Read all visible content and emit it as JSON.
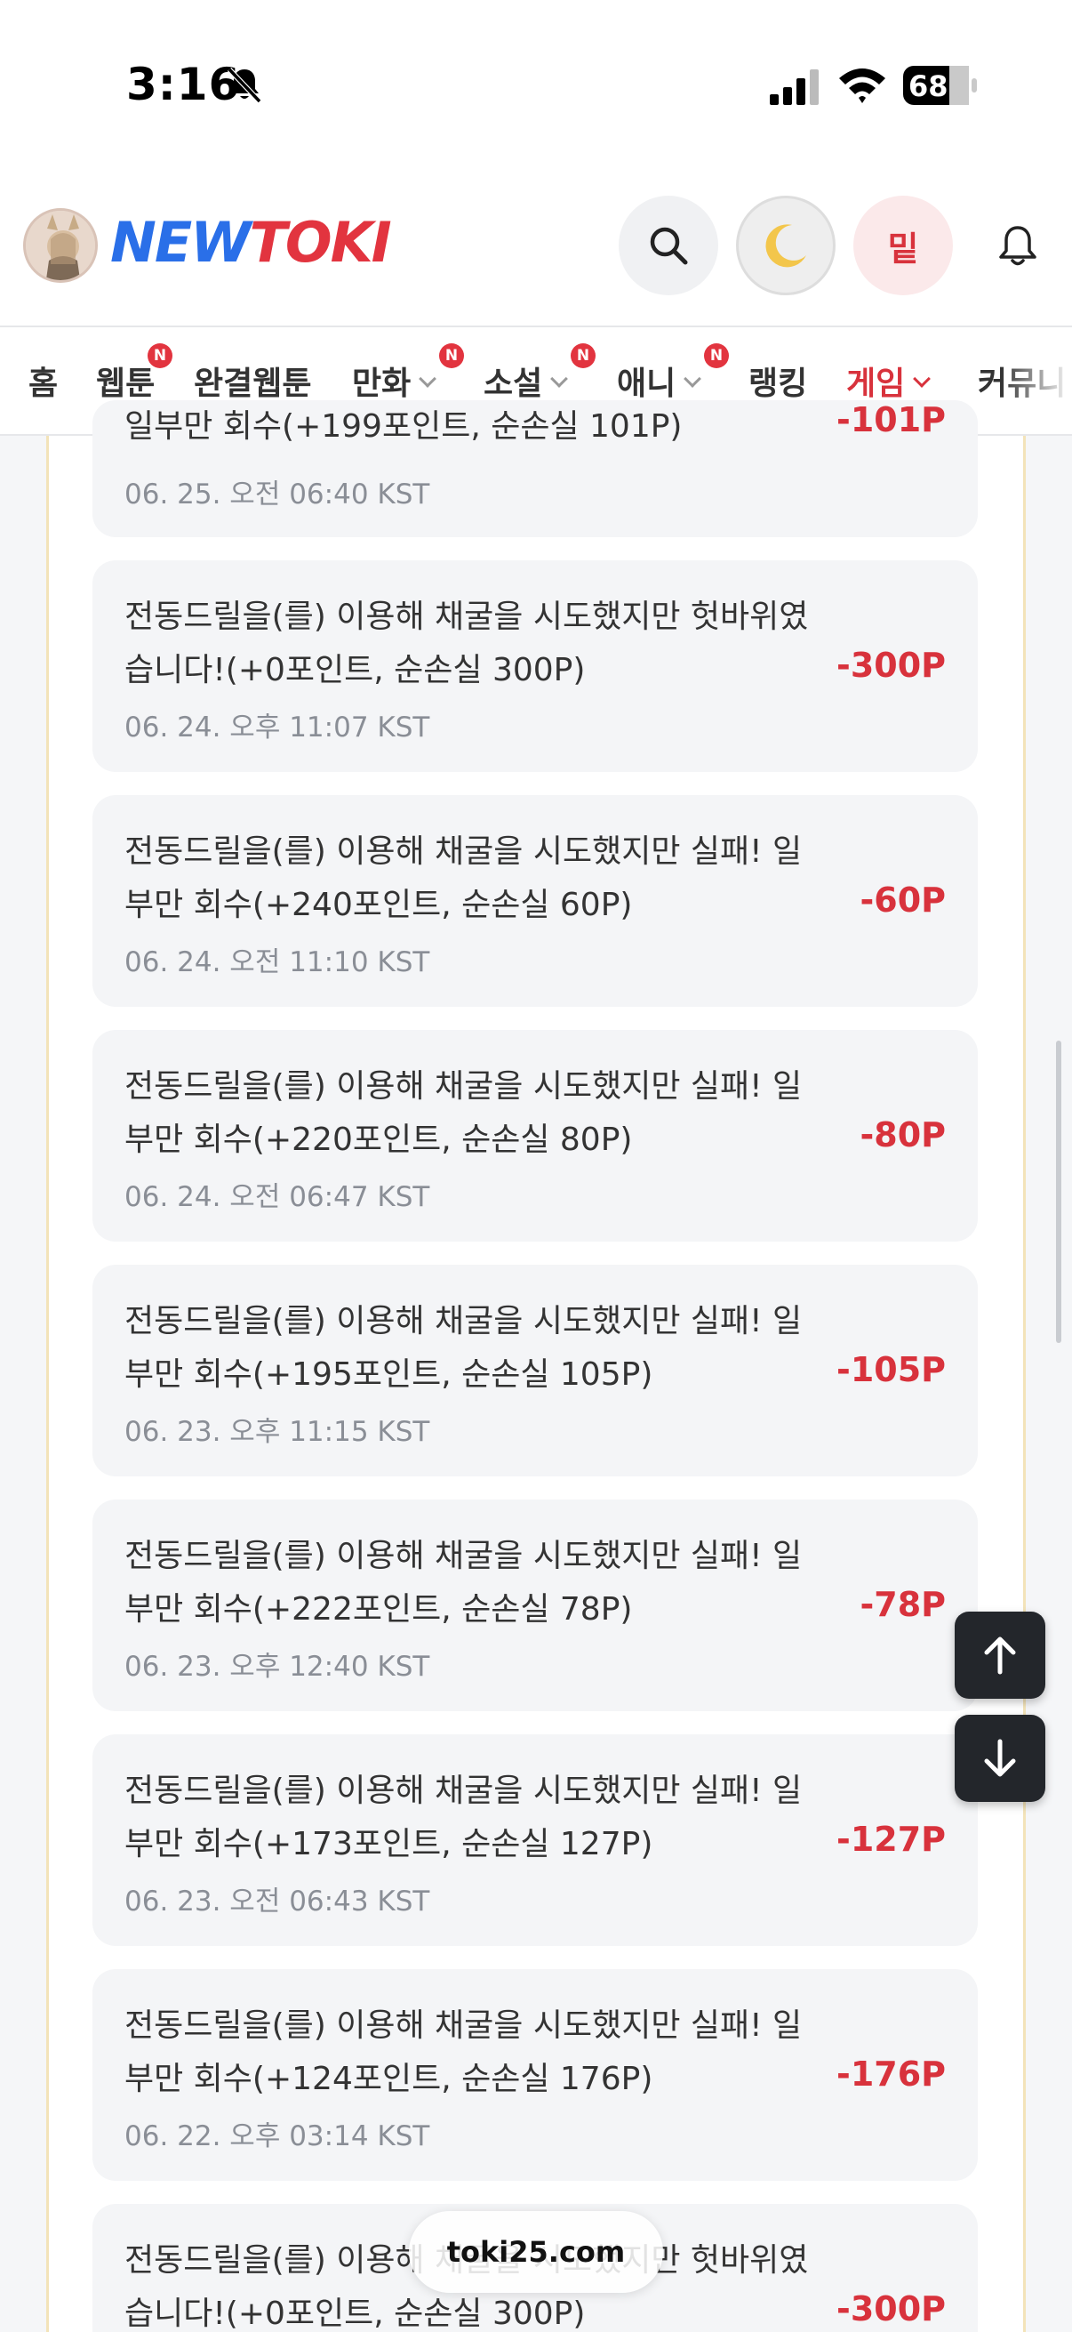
{
  "status_bar": {
    "time": "3:16",
    "battery": "68"
  },
  "header": {
    "logo_new": "NEW",
    "logo_toki": "TOKI",
    "user_initial": "밑"
  },
  "nav": {
    "items": [
      {
        "label": "홈",
        "badge": ""
      },
      {
        "label": "웹툰",
        "badge": "N"
      },
      {
        "label": "완결웹툰",
        "badge": ""
      },
      {
        "label": "만화",
        "badge": "N"
      },
      {
        "label": "소설",
        "badge": "N"
      },
      {
        "label": "애니",
        "badge": "N"
      },
      {
        "label": "랭킹",
        "badge": ""
      },
      {
        "label": "게임",
        "badge": ""
      },
      {
        "label": "커뮤니",
        "badge": ""
      }
    ]
  },
  "history": [
    {
      "desc": "일부만 회수(+199포인트, 순손실 101P)",
      "date": "06. 25. 오전 06:40 KST",
      "amount": "-101P"
    },
    {
      "desc": "전동드릴을(를) 이용해 채굴을 시도했지만 헛바위였습니다!(+0포인트, 순손실 300P)",
      "date": "06. 24. 오후 11:07 KST",
      "amount": "-300P"
    },
    {
      "desc": "전동드릴을(를) 이용해 채굴을 시도했지만 실패! 일부만 회수(+240포인트, 순손실 60P)",
      "date": "06. 24. 오전 11:10 KST",
      "amount": "-60P"
    },
    {
      "desc": "전동드릴을(를) 이용해 채굴을 시도했지만 실패! 일부만 회수(+220포인트, 순손실 80P)",
      "date": "06. 24. 오전 06:47 KST",
      "amount": "-80P"
    },
    {
      "desc": "전동드릴을(를) 이용해 채굴을 시도했지만 실패! 일부만 회수(+195포인트, 순손실 105P)",
      "date": "06. 23. 오후 11:15 KST",
      "amount": "-105P"
    },
    {
      "desc": "전동드릴을(를) 이용해 채굴을 시도했지만 실패! 일부만 회수(+222포인트, 순손실 78P)",
      "date": "06. 23. 오후 12:40 KST",
      "amount": "-78P"
    },
    {
      "desc": "전동드릴을(를) 이용해 채굴을 시도했지만 실패! 일부만 회수(+173포인트, 순손실 127P)",
      "date": "06. 23. 오전 06:43 KST",
      "amount": "-127P"
    },
    {
      "desc": "전동드릴을(를) 이용해 채굴을 시도했지만 실패! 일부만 회수(+124포인트, 순손실 176P)",
      "date": "06. 22. 오후 03:14 KST",
      "amount": "-176P"
    },
    {
      "desc": "전동드릴을(를) 이용해 채굴을 시도했지만 헛바위였습니다!(+0포인트, 순손실 300P)",
      "date": "",
      "amount": "-300P"
    }
  ],
  "url_bar": {
    "domain": "toki25.com"
  }
}
